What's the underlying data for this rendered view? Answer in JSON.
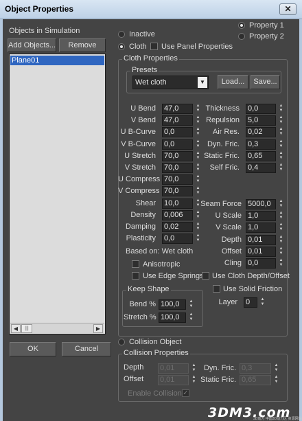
{
  "window": {
    "title": "Object Properties",
    "close_glyph": "✕"
  },
  "objects_panel": {
    "heading": "Objects in Simulation",
    "add_label": "Add Objects...",
    "remove_label": "Remove",
    "items": [
      "Plane01"
    ],
    "scroll_left": "◀",
    "scroll_right": "▶",
    "scroll_thumb": "|||"
  },
  "properties": {
    "property1": "Property 1",
    "property2": "Property 2",
    "selected": "Property 1"
  },
  "mode": {
    "inactive_label": "Inactive",
    "cloth_label": "Cloth",
    "use_panel_label": "Use Panel Properties",
    "collision_label": "Collision Object",
    "selected": "Cloth"
  },
  "cloth": {
    "group_title": "Cloth Properties",
    "presets_title": "Presets",
    "preset_value": "Wet cloth",
    "load_label": "Load...",
    "save_label": "Save...",
    "params_left": [
      {
        "label": "U Bend",
        "value": "47,0"
      },
      {
        "label": "V Bend",
        "value": "47,0"
      },
      {
        "label": "U B-Curve",
        "value": "0,0"
      },
      {
        "label": "V B-Curve",
        "value": "0,0"
      },
      {
        "label": "U Stretch",
        "value": "70,0"
      },
      {
        "label": "V Stretch",
        "value": "70,0"
      },
      {
        "label": "U Compress",
        "value": "70,0"
      },
      {
        "label": "V Compress",
        "value": "70,0"
      },
      {
        "label": "Shear",
        "value": "10,0"
      },
      {
        "label": "Density",
        "value": "0,006"
      },
      {
        "label": "Damping",
        "value": "0,02"
      },
      {
        "label": "Plasticity",
        "value": "0,0"
      }
    ],
    "params_right": [
      {
        "label": "Thickness",
        "value": "0,0"
      },
      {
        "label": "Repulsion",
        "value": "5,0"
      },
      {
        "label": "Air Res.",
        "value": "0,02"
      },
      {
        "label": "Dyn. Fric.",
        "value": "0,3"
      },
      {
        "label": "Static Fric.",
        "value": "0,65"
      },
      {
        "label": "Self Fric.",
        "value": "0,4"
      }
    ],
    "params_right_lower": [
      {
        "label": "Seam Force",
        "value": "5000,0"
      },
      {
        "label": "U Scale",
        "value": "1,0"
      },
      {
        "label": "V Scale",
        "value": "1,0"
      },
      {
        "label": "Depth",
        "value": "0,01"
      },
      {
        "label": "Offset",
        "value": "0,01"
      },
      {
        "label": "Cling",
        "value": "0,0"
      }
    ],
    "based_on": "Based on: Wet cloth",
    "anisotropic_label": "Anisotropic",
    "edge_springs_label": "Use Edge Springs",
    "cloth_depth_label": "Use Cloth Depth/Offset",
    "solid_friction_label": "Use Solid Friction",
    "layer_label": "Layer",
    "layer_value": "0",
    "keep_shape": {
      "title": "Keep Shape",
      "bend_label": "Bend %",
      "bend_value": "100,0",
      "stretch_label": "Stretch %",
      "stretch_value": "100,0"
    }
  },
  "collision": {
    "group_title": "Collision Properties",
    "depth_label": "Depth",
    "depth_value": "0,01",
    "offset_label": "Offset",
    "offset_value": "0,01",
    "dyn_fric_label": "Dyn. Fric.",
    "dyn_fric_value": "0,3",
    "static_fric_label": "Static Fric.",
    "static_fric_value": "0,65",
    "enable_label": "Enable Collisions",
    "enable_checked": true
  },
  "footer": {
    "ok_label": "OK",
    "cancel_label": "Cancel"
  },
  "watermark": {
    "text": "3DM3.com",
    "sub": "3D动力 中国3D动力区 资源网站"
  },
  "icons": {
    "spinner": "spinner-arrows-icon",
    "dropdown": "dropdown-arrow-icon",
    "check": "checkmark-icon"
  }
}
